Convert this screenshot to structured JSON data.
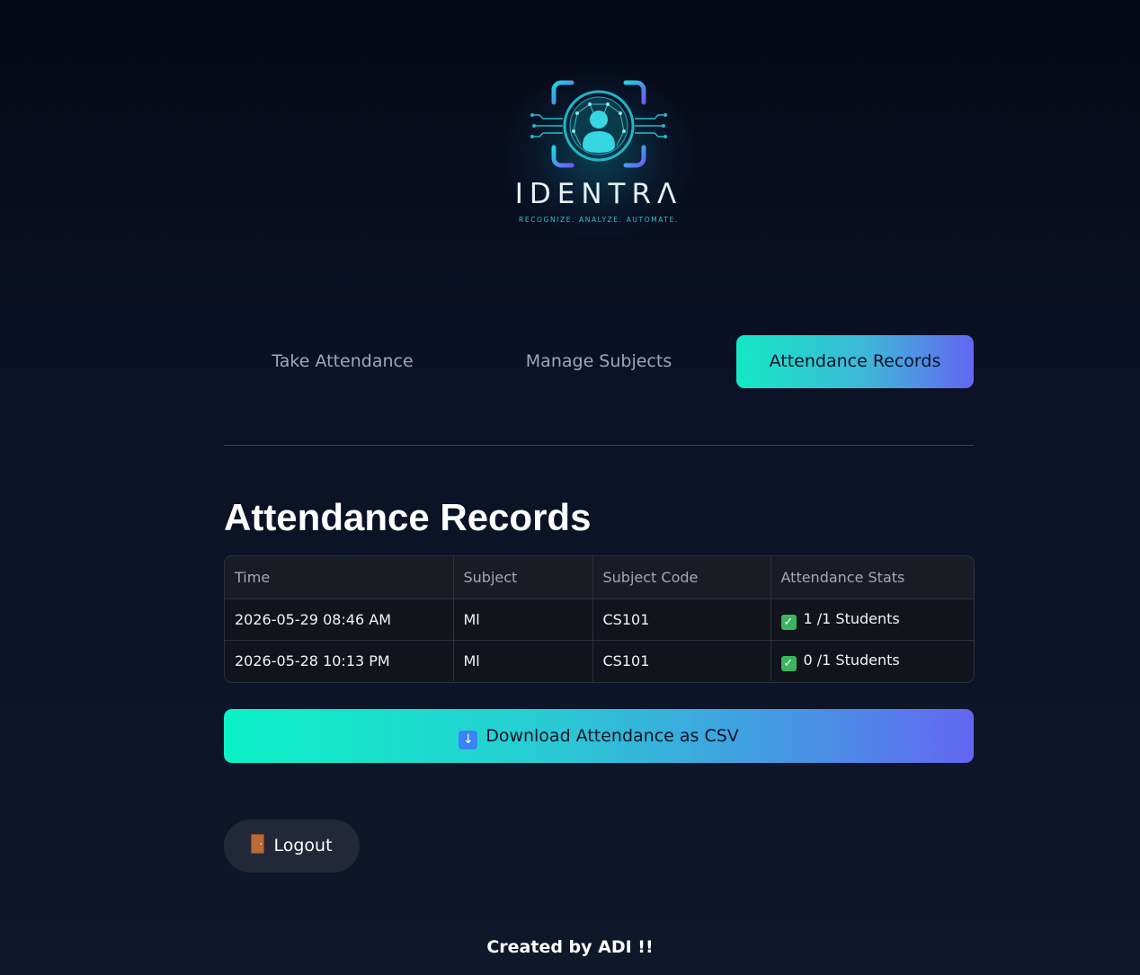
{
  "logo": {
    "wordmark": "IDENTRΛ",
    "tagline": "RECOGNIZE. ANALYZE. AUTOMATE.",
    "colors": {
      "cyan": "#1ed3e0",
      "violet": "#6d5cf0",
      "glow": "#14a0b4"
    }
  },
  "tabs": [
    {
      "label": "Take Attendance",
      "active": false
    },
    {
      "label": "Manage Subjects",
      "active": false
    },
    {
      "label": "Attendance Records",
      "active": true
    }
  ],
  "page": {
    "title": "Attendance Records"
  },
  "table": {
    "columns": [
      "Time",
      "Subject",
      "Subject Code",
      "Attendance Stats"
    ],
    "rows": [
      {
        "time": "2026-05-29 08:46 AM",
        "subject": "Ml",
        "code": "CS101",
        "stats": "1 /1 Students",
        "stats_icon": "check-mark-icon"
      },
      {
        "time": "2026-05-28 10:13 PM",
        "subject": "Ml",
        "code": "CS101",
        "stats": "0 /1 Students",
        "stats_icon": "check-mark-icon"
      }
    ]
  },
  "download": {
    "label": "Download Attendance as CSV",
    "icon": "down-arrow-icon"
  },
  "logout": {
    "label": "Logout",
    "icon": "door-icon"
  },
  "footer": {
    "text": "Created by ADI !!"
  },
  "theme": {
    "accent_start": "#0cf2c6",
    "accent_end": "#6366f1",
    "background": "#0b1226"
  }
}
